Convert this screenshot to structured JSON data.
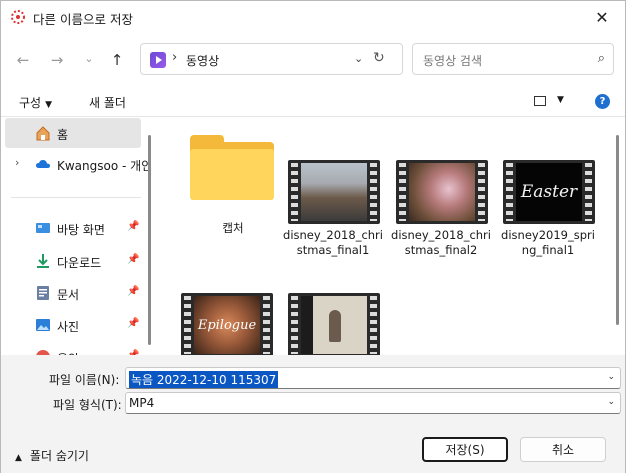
{
  "window": {
    "title": "다른 이름으로 저장"
  },
  "nav": {
    "back": "←",
    "forward": "→",
    "recent": "⌄",
    "up": "↑",
    "address": {
      "location": "동영상",
      "separator": "›"
    },
    "search": {
      "placeholder": "동영상 검색"
    }
  },
  "toolbar": {
    "organize": "구성",
    "new_folder": "새 폴더",
    "help": "?"
  },
  "sidebar": {
    "items": [
      {
        "label": "홈",
        "icon": "home-icon",
        "selected": true
      },
      {
        "label": "Kwangsoo - 개인",
        "icon": "cloud-icon",
        "expandable": true
      },
      {
        "label": "바탕 화면",
        "icon": "desktop-icon",
        "pinned": true
      },
      {
        "label": "다운로드",
        "icon": "download-icon",
        "pinned": true
      },
      {
        "label": "문서",
        "icon": "document-icon",
        "pinned": true
      },
      {
        "label": "사진",
        "icon": "pictures-icon",
        "pinned": true
      },
      {
        "label": "음악",
        "icon": "music-icon",
        "pinned": true
      }
    ]
  },
  "files": [
    {
      "name": "캡처",
      "type": "folder"
    },
    {
      "name": "disney_2018_christmas_final1",
      "type": "video"
    },
    {
      "name": "disney_2018_christmas_final2",
      "type": "video"
    },
    {
      "name": "disney2019_spring_final1",
      "type": "video",
      "thumb_text": "Easter"
    },
    {
      "name": "",
      "type": "video",
      "thumb_text": "Epilogue"
    },
    {
      "name": "",
      "type": "video"
    }
  ],
  "form": {
    "filename_label": "파일 이름(N):",
    "filename_value": "녹음 2022-12-10 115307",
    "filetype_label": "파일 형식(T):",
    "filetype_value": "MP4"
  },
  "footer": {
    "hide_folders": "폴더 숨기기",
    "save": "저장(S)",
    "cancel": "취소"
  },
  "colors": {
    "accent": "#0a57c3",
    "help": "#1f6fd1",
    "folder": "#ffd55b"
  }
}
